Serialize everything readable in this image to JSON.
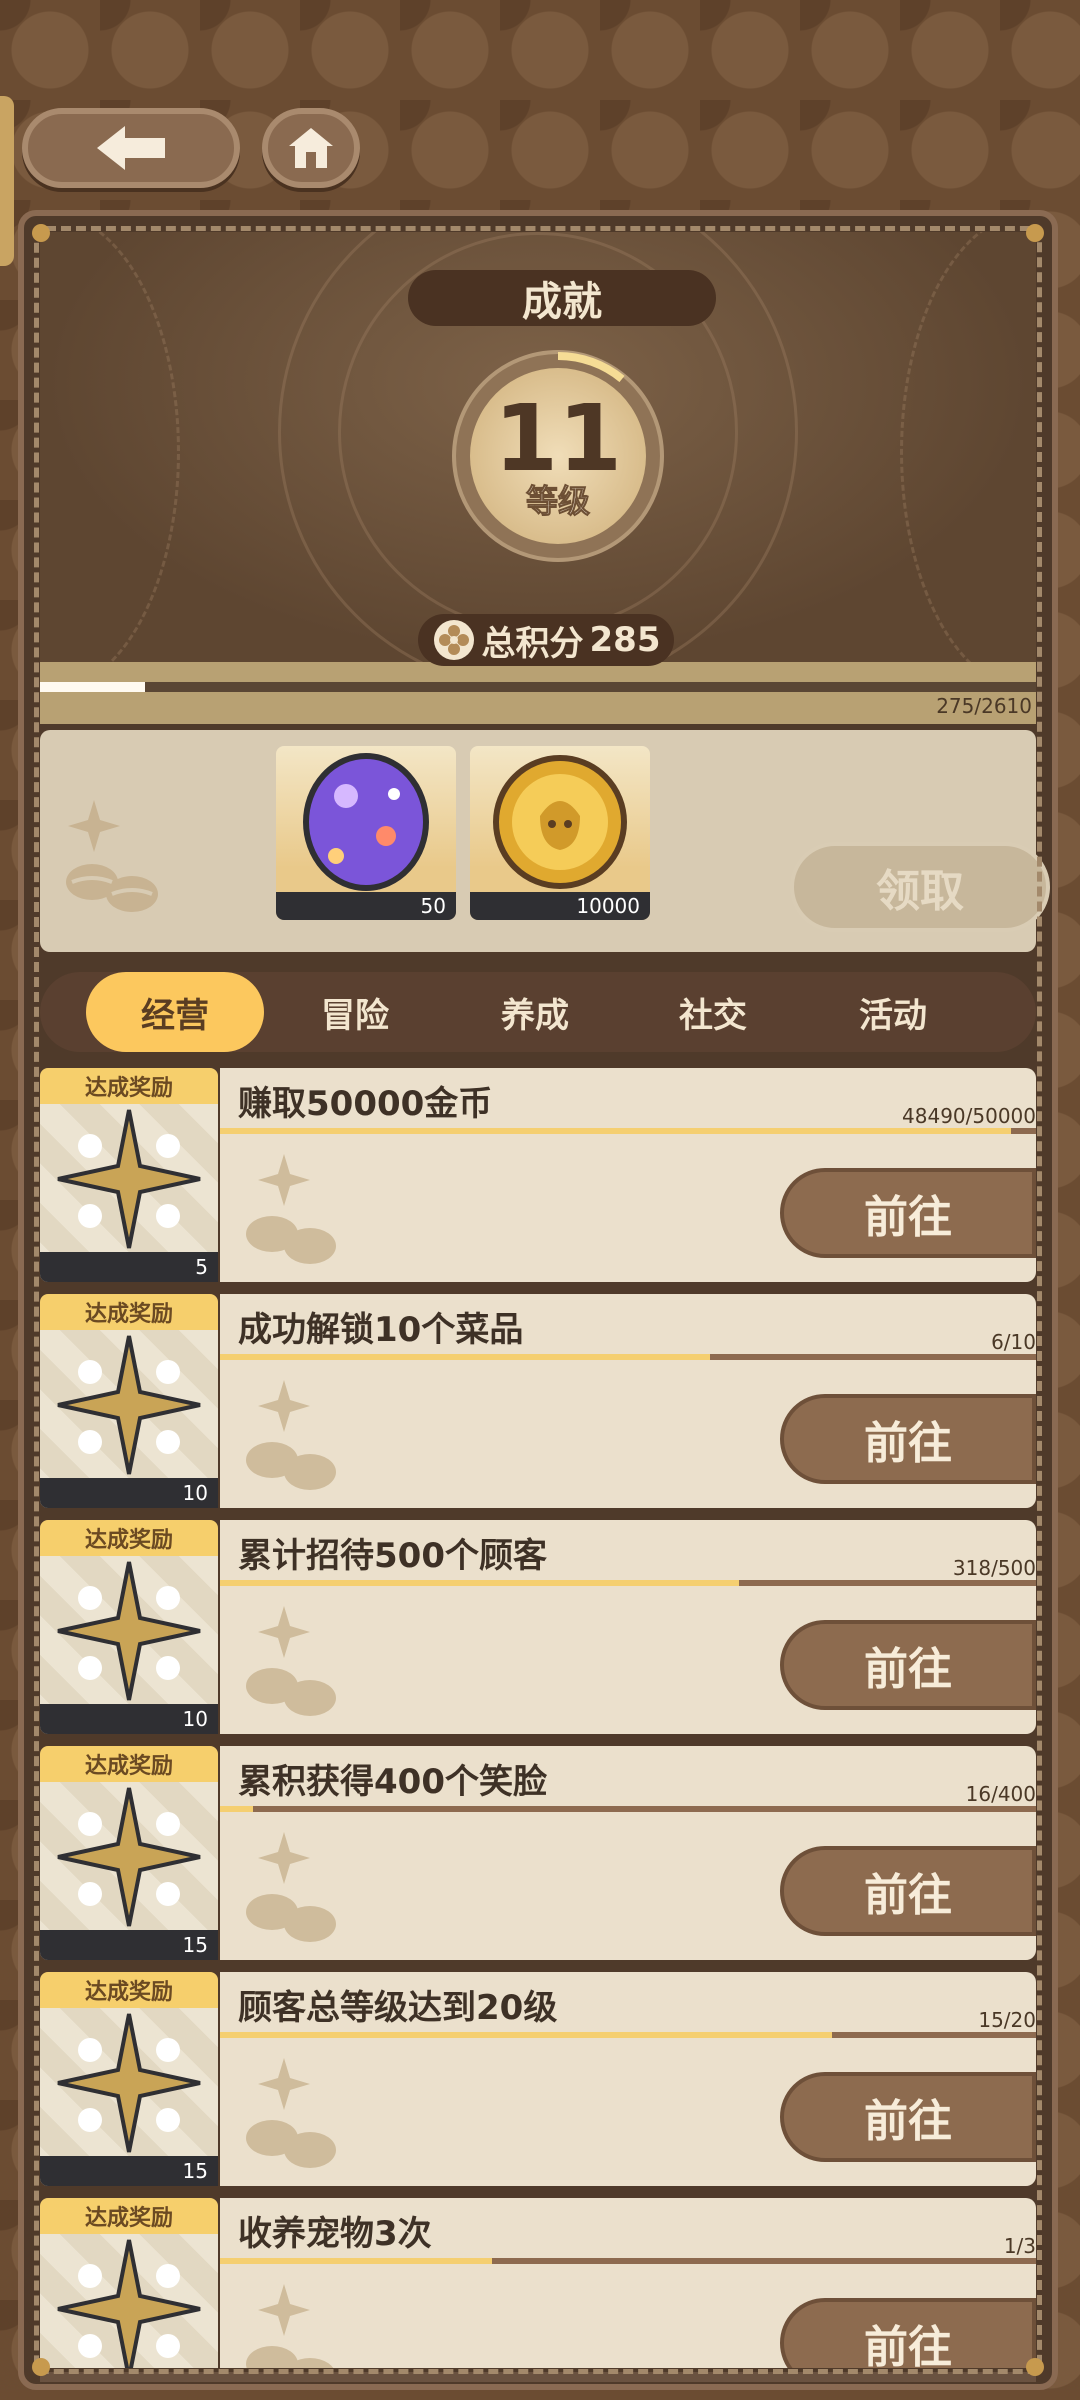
{
  "nav": {
    "back_icon": "arrow-left-icon",
    "home_icon": "home-icon"
  },
  "header": {
    "title": "成就",
    "level": "11",
    "level_label": "等级",
    "points_label": "总积分",
    "points_value": "285"
  },
  "progress": {
    "current": 275,
    "max": 2610,
    "text": "275/2610"
  },
  "reward_panel": {
    "items": [
      {
        "name": "purple-gem-egg",
        "count": "50"
      },
      {
        "name": "gold-coin",
        "count": "10000"
      }
    ],
    "claim_label": "领取"
  },
  "tabs": [
    {
      "label": "经营",
      "active": true
    },
    {
      "label": "冒险",
      "active": false
    },
    {
      "label": "养成",
      "active": false
    },
    {
      "label": "社交",
      "active": false
    },
    {
      "label": "活动",
      "active": false
    }
  ],
  "achievements": [
    {
      "reward_tag": "达成奖励",
      "reward_count": "5",
      "title": "赚取50000金币",
      "progress_text": "48490/50000",
      "progress": 0.9698,
      "button": "前往"
    },
    {
      "reward_tag": "达成奖励",
      "reward_count": "10",
      "title": "成功解锁10个菜品",
      "progress_text": "6/10",
      "progress": 0.6,
      "button": "前往"
    },
    {
      "reward_tag": "达成奖励",
      "reward_count": "10",
      "title": "累计招待500个顾客",
      "progress_text": "318/500",
      "progress": 0.636,
      "button": "前往"
    },
    {
      "reward_tag": "达成奖励",
      "reward_count": "15",
      "title": "累积获得400个笑脸",
      "progress_text": "16/400",
      "progress": 0.04,
      "button": "前往"
    },
    {
      "reward_tag": "达成奖励",
      "reward_count": "15",
      "title": "顾客总等级达到20级",
      "progress_text": "15/20",
      "progress": 0.75,
      "button": "前往"
    },
    {
      "reward_tag": "达成奖励",
      "reward_count": "",
      "title": "收养宠物3次",
      "progress_text": "1/3",
      "progress": 0.333,
      "button": "前往"
    }
  ],
  "colors": {
    "accent": "#fcc85e",
    "frame": "#4f3a2a",
    "button": "#8d6b4f"
  }
}
